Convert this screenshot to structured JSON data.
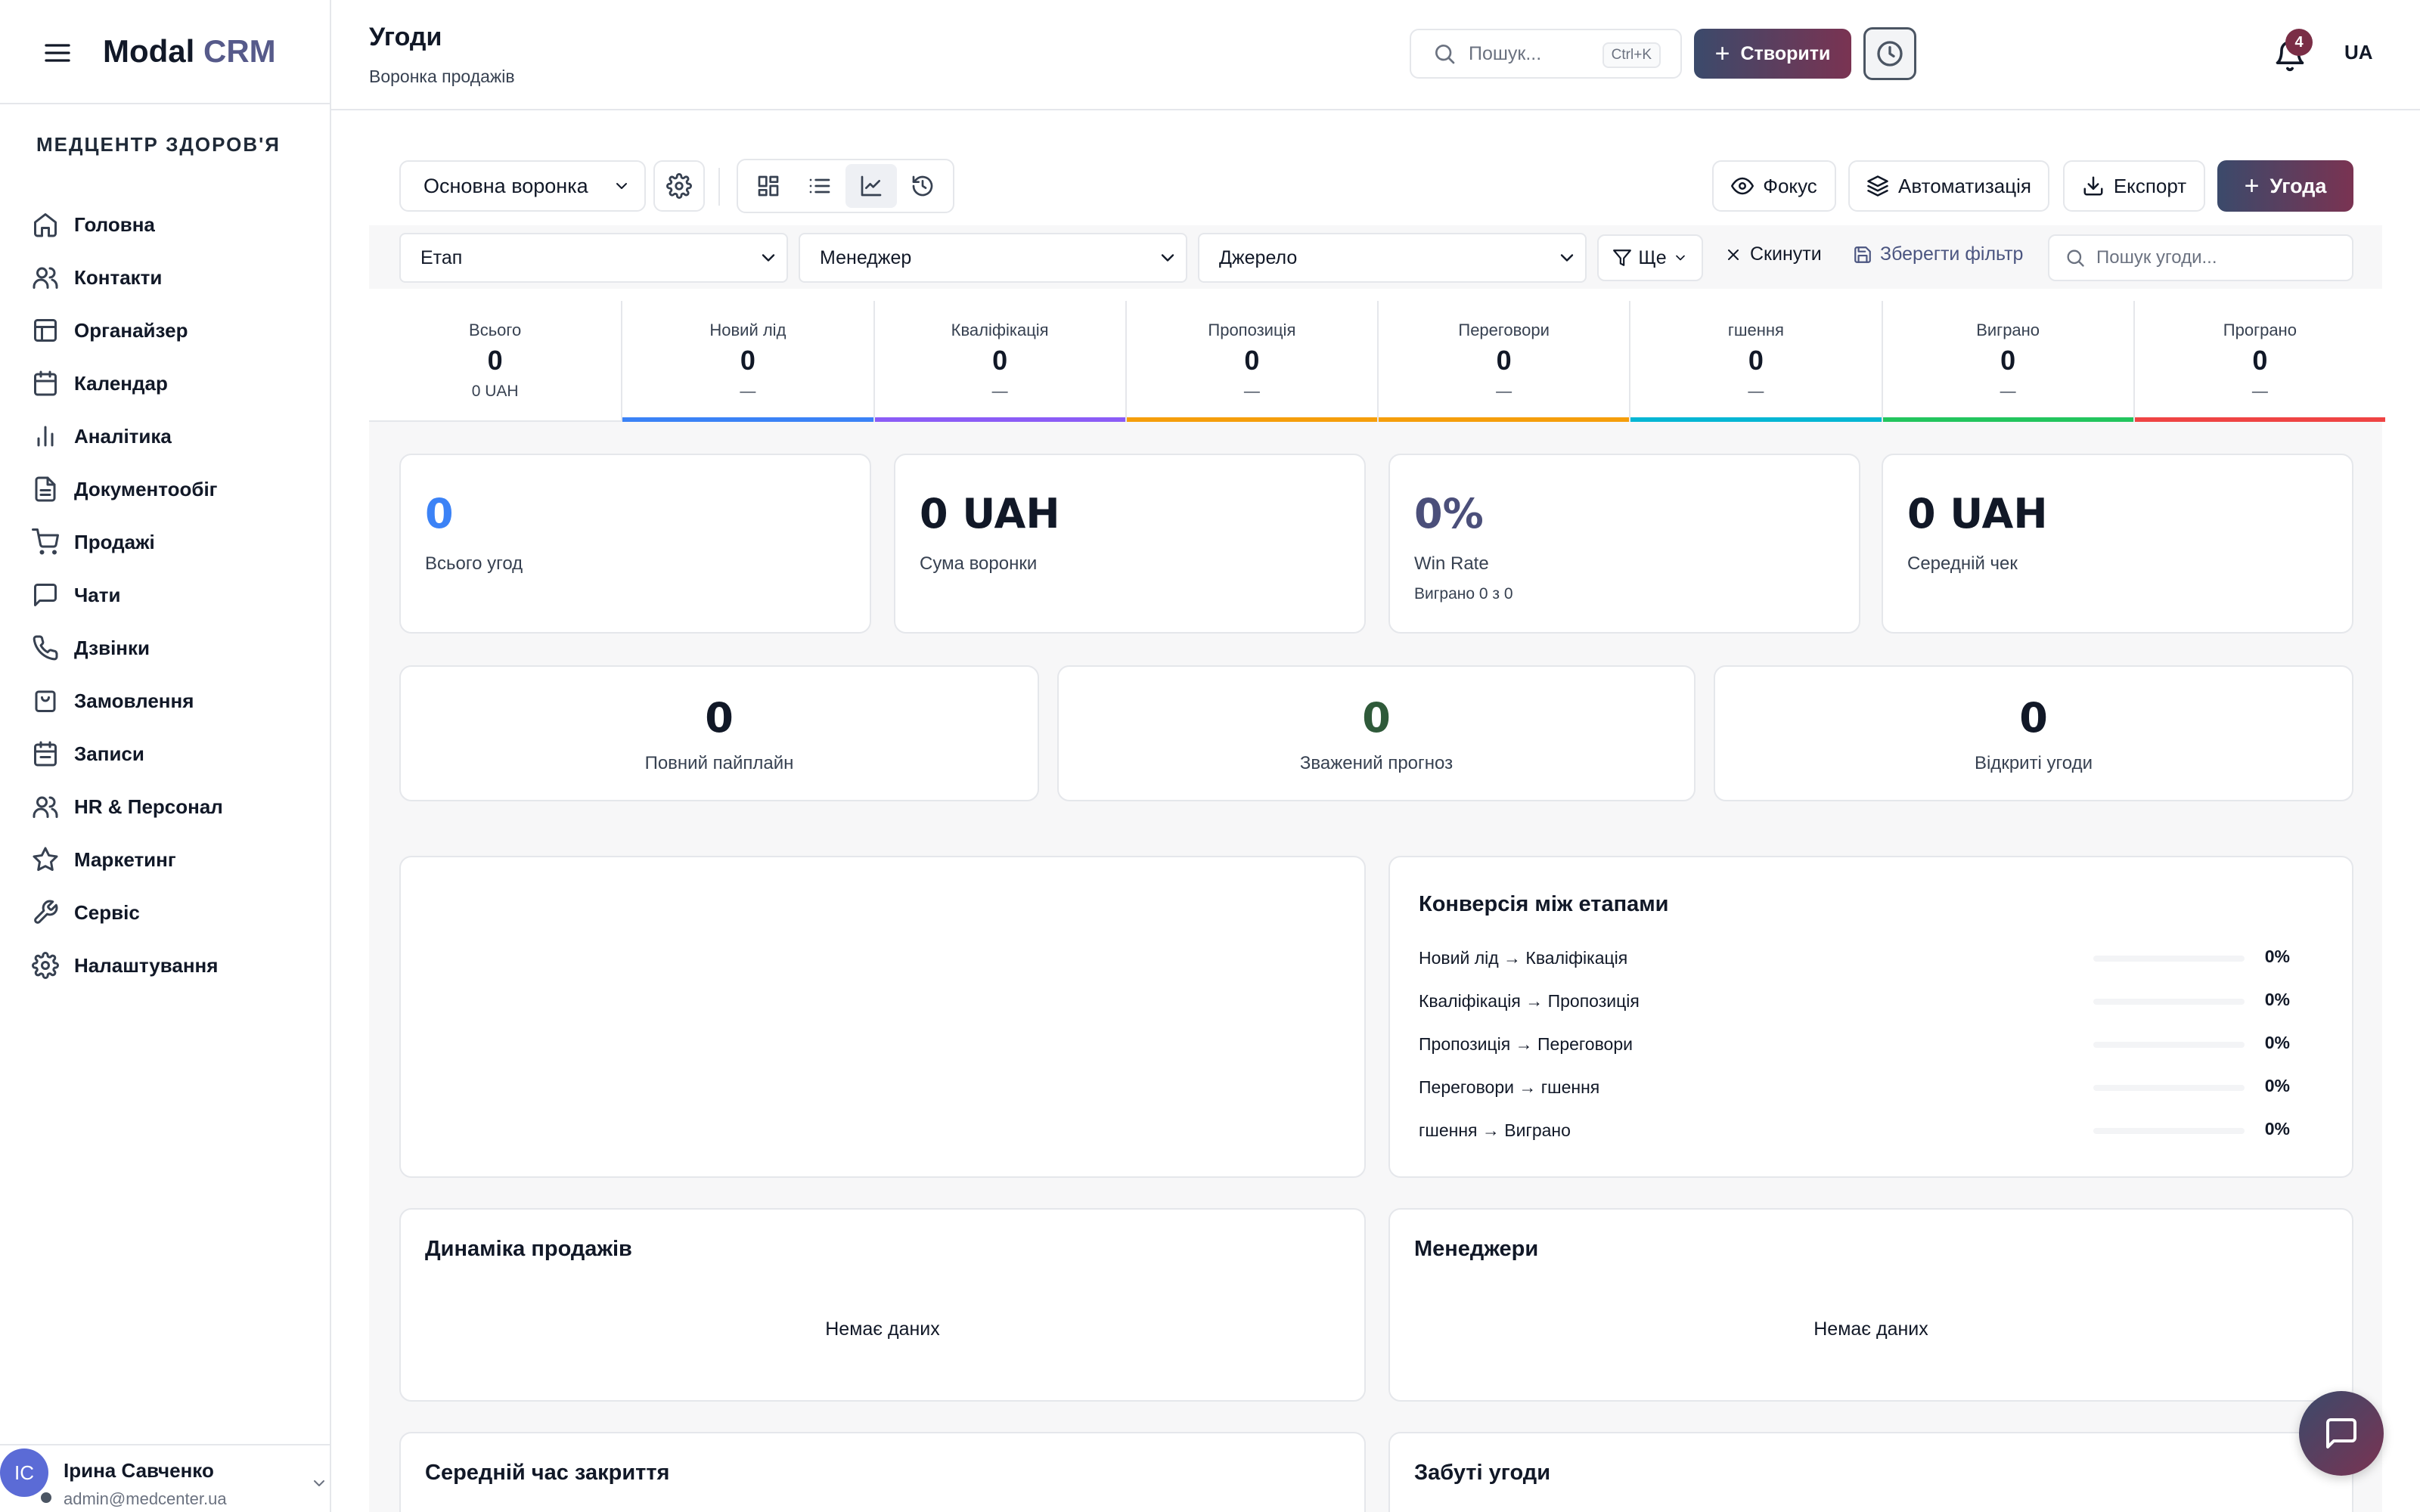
{
  "app": {
    "logo_main": "Modal",
    "logo_accent": "CRM",
    "org_name": "МЕДЦЕНТР ЗДОРОВ'Я"
  },
  "sidebar": {
    "items": [
      {
        "label": "Головна",
        "icon": "home-icon"
      },
      {
        "label": "Контакти",
        "icon": "users-icon"
      },
      {
        "label": "Органайзер",
        "icon": "layout-icon"
      },
      {
        "label": "Календар",
        "icon": "calendar-icon"
      },
      {
        "label": "Аналітика",
        "icon": "bar-chart-icon"
      },
      {
        "label": "Документообіг",
        "icon": "file-text-icon"
      },
      {
        "label": "Продажі",
        "icon": "cart-icon"
      },
      {
        "label": "Чати",
        "icon": "message-icon"
      },
      {
        "label": "Дзвінки",
        "icon": "phone-icon"
      },
      {
        "label": "Замовлення",
        "icon": "bag-icon"
      },
      {
        "label": "Записи",
        "icon": "calendar-check-icon"
      },
      {
        "label": "HR & Персонал",
        "icon": "users-icon"
      },
      {
        "label": "Маркетинг",
        "icon": "star-icon"
      },
      {
        "label": "Сервіс",
        "icon": "wrench-icon"
      },
      {
        "label": "Налаштування",
        "icon": "gear-icon"
      }
    ]
  },
  "user": {
    "initials": "IC",
    "name": "Ірина Савченко",
    "email": "admin@medcenter.ua"
  },
  "header": {
    "title": "Угоди",
    "subtitle": "Воронка продажів",
    "search_placeholder": "Пошук...",
    "search_shortcut": "Ctrl+K",
    "create_label": "Створити",
    "notification_count": "4",
    "language": "UA"
  },
  "toolbar": {
    "pipeline_selected": "Основна воронка",
    "focus_label": "Фокус",
    "automation_label": "Автоматизація",
    "export_label": "Експорт",
    "deal_label": "Угода"
  },
  "filters": {
    "stage": "Етап",
    "manager": "Менеджер",
    "source": "Джерело",
    "more": "Ще",
    "reset": "Скинути",
    "save": "Зберегти фільтр",
    "search_placeholder": "Пошук угоди..."
  },
  "stages": [
    {
      "name": "Всього",
      "count": "0",
      "sub": "0 UAH",
      "color": ""
    },
    {
      "name": "Новий лід",
      "count": "0",
      "sub": "—",
      "color": "#3b82f6"
    },
    {
      "name": "Кваліфікація",
      "count": "0",
      "sub": "—",
      "color": "#8b5cf6"
    },
    {
      "name": "Пропозиція",
      "count": "0",
      "sub": "—",
      "color": "#f59e0b"
    },
    {
      "name": "Переговори",
      "count": "0",
      "sub": "—",
      "color": "#f59e0b"
    },
    {
      "name": "гшення",
      "count": "0",
      "sub": "—",
      "color": "#06b6d4"
    },
    {
      "name": "Виграно",
      "count": "0",
      "sub": "—",
      "color": "#22c55e"
    },
    {
      "name": "Програно",
      "count": "0",
      "sub": "—",
      "color": "#ef4444"
    }
  ],
  "kpis": [
    {
      "value": "0",
      "label": "Всього угод",
      "sub": "",
      "color": "#3b82f6"
    },
    {
      "value": "0 UAH",
      "label": "Сума воронки",
      "sub": "",
      "color": "#111827"
    },
    {
      "value": "0%",
      "label": "Win Rate",
      "sub": "Виграно 0 з 0",
      "color": "#4b4f7a"
    },
    {
      "value": "0 UAH",
      "label": "Середній чек",
      "sub": "",
      "color": "#111827"
    }
  ],
  "pipeline_stats": [
    {
      "value": "0",
      "label": "Повний пайплайн",
      "color": "#111827"
    },
    {
      "value": "0",
      "label": "Зважений прогноз",
      "color": "#2f5a3a"
    },
    {
      "value": "0",
      "label": "Відкриті угоди",
      "color": "#111827"
    }
  ],
  "conversion": {
    "title": "Конверсія між етапами",
    "rows": [
      {
        "label": "Новий лід → Кваліфікація",
        "pct": "0%"
      },
      {
        "label": "Кваліфікація → Пропозиція",
        "pct": "0%"
      },
      {
        "label": "Пропозиція → Переговори",
        "pct": "0%"
      },
      {
        "label": "Переговори → гшення",
        "pct": "0%"
      },
      {
        "label": "гшення → Виграно",
        "pct": "0%"
      }
    ]
  },
  "sales_dynamics": {
    "title": "Динаміка продажів",
    "empty": "Немає даних"
  },
  "managers": {
    "title": "Менеджери",
    "empty": "Немає даних"
  },
  "avg_close": {
    "title": "Середній час закриття"
  },
  "forgotten": {
    "title": "Забуті угоди"
  }
}
